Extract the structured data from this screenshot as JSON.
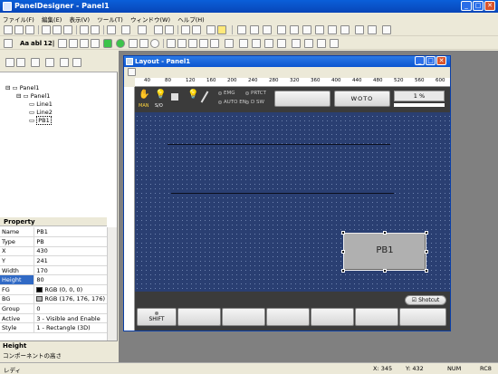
{
  "app": {
    "title": "PanelDesigner - Panel1"
  },
  "menu": [
    "ファイル(F)",
    "編集(E)",
    "表示(V)",
    "ツール(T)",
    "ウィンドウ(W)",
    "ヘルプ(H)"
  ],
  "toolbar2": {
    "text_tools": [
      "Aa",
      "abl",
      "12|"
    ]
  },
  "tree": {
    "items": [
      "Panel1",
      "Panel1",
      "Line1",
      "Line2",
      "PB1"
    ]
  },
  "properties": {
    "header": "Property",
    "rows": [
      {
        "k": "Name",
        "v": "PB1"
      },
      {
        "k": "Type",
        "v": "PB"
      },
      {
        "k": "X",
        "v": "430"
      },
      {
        "k": "Y",
        "v": "241"
      },
      {
        "k": "Width",
        "v": "170"
      },
      {
        "k": "Height",
        "v": "80"
      },
      {
        "k": "FG",
        "v": "RGB (0, 0, 0)"
      },
      {
        "k": "BG",
        "v": "RGB (176, 176, 176)"
      },
      {
        "k": "Group",
        "v": "0"
      },
      {
        "k": "Active",
        "v": "3 - Visible and Enable"
      },
      {
        "k": "Style",
        "v": "1 - Rectangle (3D)"
      }
    ],
    "selected_index": 5
  },
  "description": {
    "title": "Height",
    "text": "コンポーネントの高さ"
  },
  "layout": {
    "title": "Layout - Panel1",
    "ruler_labels": [
      "40",
      "80",
      "120",
      "160",
      "200",
      "240",
      "280",
      "320",
      "360",
      "400",
      "440",
      "480",
      "520",
      "560",
      "600"
    ],
    "header_icons": {
      "man": "MAN",
      "sio": "S/O"
    },
    "lamps": [
      "EMG",
      "PRTCT",
      "AUTO EN",
      "D SW"
    ],
    "display_btn": "WOTO",
    "percent": "1 %",
    "pb_label": "PB1",
    "shotcut_label": "Shotcut",
    "shift_label": "SHIFT"
  },
  "status": {
    "left": "レディ",
    "x": "X: 345",
    "y": "Y: 432",
    "num": "NUM",
    "rc": "RC8"
  },
  "colors": {
    "canvas": "#2a3f72",
    "titlebar": "#0a5fd9",
    "pb_bg": "#b0b0b0"
  }
}
